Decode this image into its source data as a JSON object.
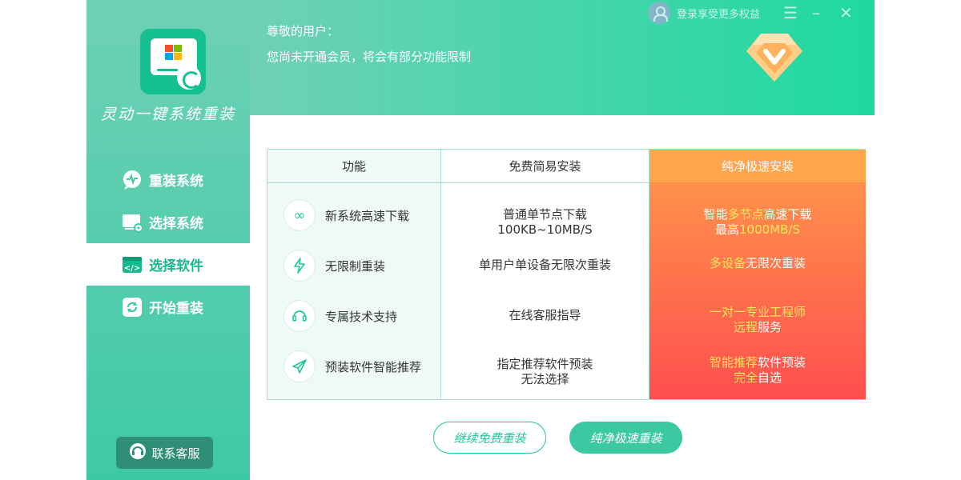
{
  "app": {
    "title": "灵动一键系统重装"
  },
  "sidebar": {
    "items": [
      {
        "label": "重装系统",
        "icon": "pulse-chat-icon",
        "active": false
      },
      {
        "label": "选择系统",
        "icon": "monitor-icon",
        "active": false
      },
      {
        "label": "选择软件",
        "icon": "code-window-icon",
        "active": true
      },
      {
        "label": "开始重装",
        "icon": "refresh-icon",
        "active": false
      }
    ],
    "contact_label": "联系客服"
  },
  "header": {
    "greeting": "尊敬的用户：",
    "notice": "您尚未开通会员，将会有部分功能限制",
    "login_text": "登录享受更多权益"
  },
  "table": {
    "headers": [
      "功能",
      "免费简易安装",
      "纯净极速安装"
    ],
    "rows": [
      {
        "feature": "新系统高速下载",
        "icon": "infinity-icon",
        "free": [
          "普通单节点下载",
          "100KB~10MB/S"
        ],
        "premium": [
          [
            {
              "t": "智能",
              "hl": false
            },
            {
              "t": "多节点",
              "hl": true
            },
            {
              "t": "高速下载",
              "hl": false
            }
          ],
          [
            {
              "t": "最高",
              "hl": false
            },
            {
              "t": "1000MB/S",
              "hl": true
            }
          ]
        ]
      },
      {
        "feature": "无限制重装",
        "icon": "lightning-icon",
        "free": [
          "单用户单设备无限次重装"
        ],
        "premium": [
          [
            {
              "t": "多设备",
              "hl": true
            },
            {
              "t": "无限次重装",
              "hl": false
            }
          ]
        ]
      },
      {
        "feature": "专属技术支持",
        "icon": "headset-icon",
        "free": [
          "在线客服指导"
        ],
        "premium": [
          [
            {
              "t": "一对一专业工程师",
              "hl": true
            }
          ],
          [
            {
              "t": "远程",
              "hl": true
            },
            {
              "t": "服务",
              "hl": false
            }
          ]
        ]
      },
      {
        "feature": "预装软件智能推荐",
        "icon": "paper-plane-icon",
        "free": [
          "指定推荐软件预装",
          "无法选择"
        ],
        "premium": [
          [
            {
              "t": "智能推荐",
              "hl": true
            },
            {
              "t": "软件预装",
              "hl": false
            }
          ],
          [
            {
              "t": "完全",
              "hl": true
            },
            {
              "t": "自选",
              "hl": false
            }
          ]
        ]
      }
    ]
  },
  "buttons": {
    "free": "继续免费重装",
    "pure": "纯净极速重装"
  },
  "colors": {
    "accent": "#1ec89a",
    "premium_top": "#ff9a4a",
    "premium_bottom": "#ff4f4f",
    "highlight": "#ffe75a"
  }
}
